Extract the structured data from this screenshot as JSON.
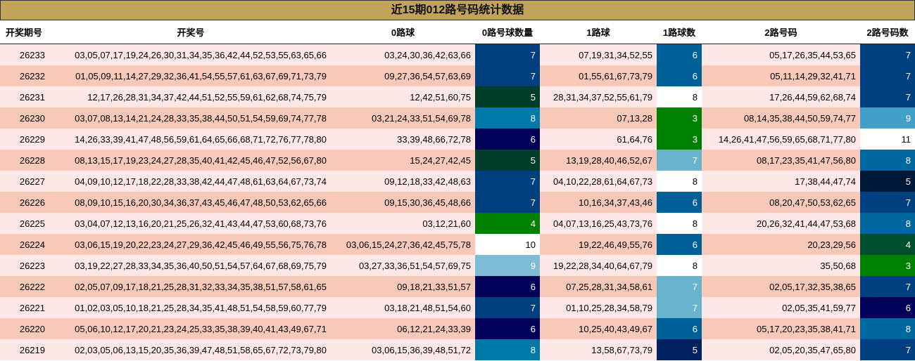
{
  "title": "近15期012路号码统计数据",
  "headers": [
    "开奖期号",
    "开奖号",
    "0路球",
    "0路号球数量",
    "1路球",
    "1路球数",
    "2路号码",
    "2路号码数"
  ],
  "colors": {
    "title_bg": "#c2a35c",
    "row_light": "#fde7e7",
    "row_dark": "#f8c9b8",
    "scale": {
      "3": "#008000",
      "4": "#008000",
      "5": "#003e2a",
      "6": "#003a80",
      "7": "#004080",
      "8": "#0070a0",
      "9": "#7ebcd6",
      "10": "#ffffff",
      "11": "#ffffff"
    }
  },
  "rows": [
    {
      "issue": "26233",
      "numbers": "03,05,07,17,19,24,26,30,31,34,35,36,42,44,52,53,55,63,65,66",
      "r0": "03,24,30,36,42,63,66",
      "c0": "7",
      "r1": "07,19,31,34,52,55",
      "c1": "6",
      "r2": "05,17,26,35,44,53,65",
      "c2": "7"
    },
    {
      "issue": "26232",
      "numbers": "01,05,09,11,14,27,29,32,36,41,54,55,57,61,63,67,69,71,73,79",
      "r0": "09,27,36,54,57,63,69",
      "c0": "7",
      "r1": "01,55,61,67,73,79",
      "c1": "6",
      "r2": "05,11,14,29,32,41,71",
      "c2": "7"
    },
    {
      "issue": "26231",
      "numbers": "12,17,26,28,31,34,37,42,44,51,52,55,59,61,62,68,74,75,79",
      "r0": "12,42,51,60,75",
      "c0": "5",
      "r1": "28,31,34,37,52,55,61,79",
      "c1": "8",
      "r2": "17,26,44,59,62,68,74",
      "c2": "7"
    },
    {
      "issue": "26230",
      "numbers": "03,07,08,13,14,21,24,28,33,35,38,44,50,51,54,59,69,74,77,78",
      "r0": "03,21,24,33,51,54,69,78",
      "c0": "8",
      "r1": "07,13,28",
      "c1": "3",
      "r2": "08,14,35,38,44,50,59,74,77",
      "c2": "9"
    },
    {
      "issue": "26229",
      "numbers": "14,26,33,39,41,47,48,56,59,61,64,65,66,68,71,72,76,77,78,80",
      "r0": "33,39,48,66,72,78",
      "c0": "6",
      "r1": "61,64,76",
      "c1": "3",
      "r2": "14,26,41,47,56,59,65,68,71,77,80",
      "c2": "11"
    },
    {
      "issue": "26228",
      "numbers": "08,13,15,17,19,23,24,27,28,35,40,41,42,45,46,47,52,56,67,80",
      "r0": "15,24,27,42,45",
      "c0": "5",
      "r1": "13,19,28,40,46,52,67",
      "c1": "7",
      "r2": "08,17,23,35,41,47,56,80",
      "c2": "8"
    },
    {
      "issue": "26227",
      "numbers": "04,09,10,12,17,18,22,28,33,38,42,44,47,48,61,63,64,67,73,74",
      "r0": "09,12,18,33,42,48,63",
      "c0": "7",
      "r1": "04,10,22,28,61,64,67,73",
      "c1": "8",
      "r2": "17,38,44,47,74",
      "c2": "5"
    },
    {
      "issue": "26226",
      "numbers": "08,09,10,15,16,20,30,34,36,37,43,45,46,47,48,50,53,62,65,66",
      "r0": "09,15,30,36,45,48,66",
      "c0": "7",
      "r1": "10,16,34,37,43,46",
      "c1": "6",
      "r2": "08,20,47,50,53,62,65",
      "c2": "7"
    },
    {
      "issue": "26225",
      "numbers": "03,04,07,12,13,16,20,21,25,26,32,41,43,44,47,53,60,68,73,76",
      "r0": "03,12,21,60",
      "c0": "4",
      "r1": "04,07,13,16,25,43,73,76",
      "c1": "8",
      "r2": "20,26,32,41,44,47,53,68",
      "c2": "8"
    },
    {
      "issue": "26224",
      "numbers": "03,06,15,19,20,22,23,24,27,29,36,42,45,46,49,55,56,75,76,78",
      "r0": "03,06,15,24,27,36,42,45,75,78",
      "c0": "10",
      "r1": "19,22,46,49,55,76",
      "c1": "6",
      "r2": "20,23,29,56",
      "c2": "4"
    },
    {
      "issue": "26223",
      "numbers": "03,19,22,27,28,33,34,35,36,40,50,51,54,57,64,67,68,69,75,79",
      "r0": "03,27,33,36,51,54,57,69,75",
      "c0": "9",
      "r1": "19,22,28,34,40,64,67,79",
      "c1": "8",
      "r2": "35,50,68",
      "c2": "3"
    },
    {
      "issue": "26222",
      "numbers": "02,05,07,09,17,18,21,25,28,31,32,33,34,35,38,51,57,58,61,65",
      "r0": "09,18,21,33,51,57",
      "c0": "6",
      "r1": "07,25,28,31,34,58,61",
      "c1": "7",
      "r2": "02,05,17,32,35,38,65",
      "c2": "7"
    },
    {
      "issue": "26221",
      "numbers": "01,02,03,05,10,18,21,25,28,34,35,41,48,51,54,58,59,60,77,79",
      "r0": "03,18,21,48,51,54,60",
      "c0": "7",
      "r1": "01,10,25,28,34,58,79",
      "c1": "7",
      "r2": "02,05,35,41,59,77",
      "c2": "6"
    },
    {
      "issue": "26220",
      "numbers": "05,06,10,12,17,20,21,23,24,25,33,35,38,39,40,41,43,49,67,71",
      "r0": "06,12,21,24,33,39",
      "c0": "6",
      "r1": "10,25,40,43,49,67",
      "c1": "6",
      "r2": "05,17,20,23,35,38,41,71",
      "c2": "8"
    },
    {
      "issue": "26219",
      "numbers": "02,03,05,06,13,15,20,35,36,39,47,48,51,58,65,67,72,73,79,80",
      "r0": "03,06,15,36,39,48,51,72",
      "c0": "8",
      "r1": "13,58,67,73,79",
      "c1": "5",
      "r2": "02,05,20,35,47,65,80",
      "c2": "7"
    }
  ],
  "count_colors": [
    [
      "#004080",
      "#00609a",
      "#004080"
    ],
    [
      "#004080",
      "#00609a",
      "#004080"
    ],
    [
      "#003e2a",
      "#ffffff",
      "#004080"
    ],
    [
      "#0078a8",
      "#008000",
      "#40a0c8"
    ],
    [
      "#000058",
      "#008000",
      "#ffffff"
    ],
    [
      "#003e2a",
      "#68b4cc",
      "#00689e"
    ],
    [
      "#004080",
      "#ffffff",
      "#001838"
    ],
    [
      "#004080",
      "#00609a",
      "#004080"
    ],
    [
      "#008000",
      "#ffffff",
      "#00689e"
    ],
    [
      "#ffffff",
      "#00609a",
      "#004d2e"
    ],
    [
      "#7ebcd6",
      "#ffffff",
      "#008000"
    ],
    [
      "#000058",
      "#68b4cc",
      "#004080"
    ],
    [
      "#004080",
      "#68b4cc",
      "#000058"
    ],
    [
      "#000058",
      "#00609a",
      "#00689e"
    ],
    [
      "#0078a8",
      "#002060",
      "#004080"
    ]
  ]
}
